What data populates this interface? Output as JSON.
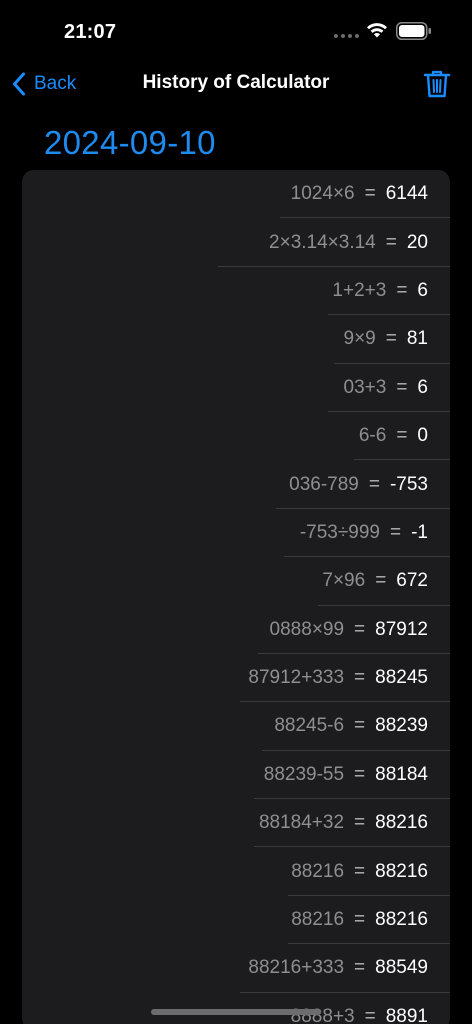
{
  "status_bar": {
    "time": "21:07"
  },
  "nav": {
    "back_label": "Back",
    "title": "History of Calculator"
  },
  "date_header": "2024-09-10",
  "colors": {
    "accent": "#1a8cff",
    "background": "#000000",
    "card": "#1c1c1e",
    "expression": "#8e8e93"
  },
  "history": [
    {
      "expression": "1024×6",
      "equals": "=",
      "result": "6144"
    },
    {
      "expression": "2×3.14×3.14",
      "equals": "=",
      "result": "20"
    },
    {
      "expression": "1+2+3",
      "equals": "=",
      "result": "6"
    },
    {
      "expression": "9×9",
      "equals": "=",
      "result": "81"
    },
    {
      "expression": "03+3",
      "equals": "=",
      "result": "6"
    },
    {
      "expression": "6-6",
      "equals": "=",
      "result": "0"
    },
    {
      "expression": "036-789",
      "equals": "=",
      "result": "-753"
    },
    {
      "expression": "-753÷999",
      "equals": "=",
      "result": "-1"
    },
    {
      "expression": "7×96",
      "equals": "=",
      "result": "672"
    },
    {
      "expression": "0888×99",
      "equals": "=",
      "result": "87912"
    },
    {
      "expression": "87912+333",
      "equals": "=",
      "result": "88245"
    },
    {
      "expression": "88245-6",
      "equals": "=",
      "result": "88239"
    },
    {
      "expression": "88239-55",
      "equals": "=",
      "result": "88184"
    },
    {
      "expression": "88184+32",
      "equals": "=",
      "result": "88216"
    },
    {
      "expression": "88216",
      "equals": "=",
      "result": "88216"
    },
    {
      "expression": "88216",
      "equals": "=",
      "result": "88216"
    },
    {
      "expression": "88216+333",
      "equals": "=",
      "result": "88549"
    },
    {
      "expression": "8888+3",
      "equals": "=",
      "result": "8891"
    }
  ]
}
